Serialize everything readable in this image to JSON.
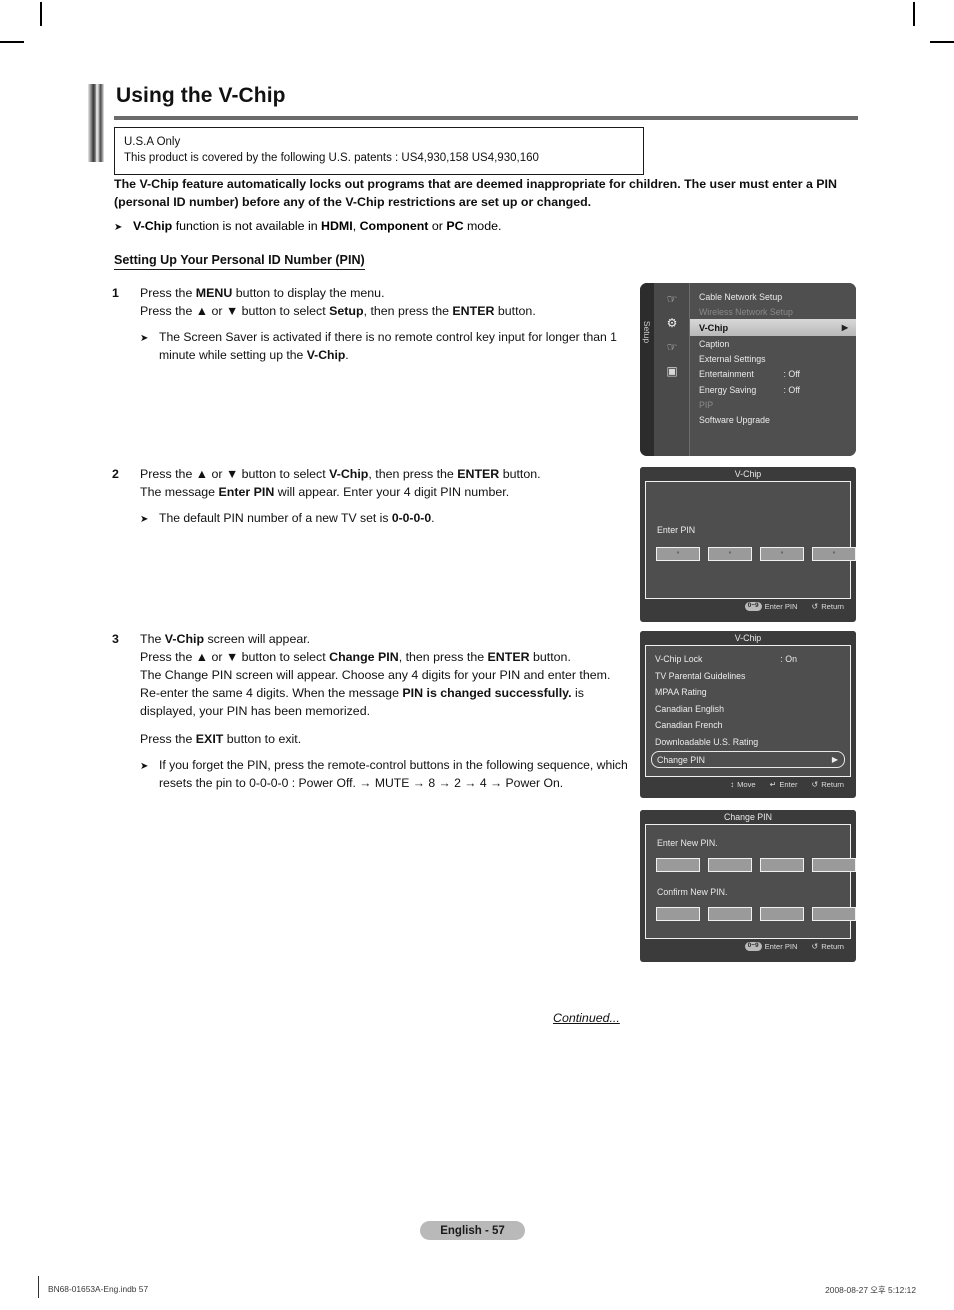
{
  "document": {
    "title": "Using the V-Chip",
    "patent_notice": {
      "line1": "U.S.A Only",
      "line2": "This product is covered by the following U.S. patents : US4,930,158 US4,930,160"
    },
    "lead_paragraph": "The V-Chip feature automatically locks out programs that are deemed inappropriate for children. The user must enter a PIN (personal ID number) before any of the V-Chip restrictions are set up or changed.",
    "lead_bullet": "V-Chip function is not available in HDMI, Component or PC mode.",
    "section_heading": "Setting Up Your Personal ID Number (PIN)",
    "continued_label": "Continued...",
    "page_label": "English - 57",
    "footer_left": "BN68-01653A-Eng.indb   57",
    "footer_right": "2008-08-27   오후 5:12:12"
  },
  "steps": [
    {
      "number": "1",
      "lines": [
        "Press the MENU button to display the menu.",
        "Press the ▲ or ▼ button to select Setup, then press the ENTER button."
      ],
      "bullet": "The Screen Saver is activated if there is no remote control key input for longer than 1 minute while setting up the V-Chip."
    },
    {
      "number": "2",
      "lines": [
        "Press the ▲ or ▼ button to select V-Chip, then press the ENTER button.",
        "The message Enter PIN will appear. Enter your 4 digit PIN number."
      ],
      "bullet": "The default PIN number of a new TV set is 0-0-0-0."
    },
    {
      "number": "3",
      "lines": [
        "The V-Chip screen will appear.",
        "Press the ▲ or ▼ button to select Change PIN, then press the ENTER button.",
        "The Change PIN screen will appear. Choose any 4 digits for your PIN and enter them. Re-enter the same 4 digits. When the message PIN is changed successfully. is displayed, your PIN has been memorized."
      ],
      "extra_line": "Press the EXIT button to exit.",
      "bullet": "If you forget the PIN, press the remote-control buttons in the following sequence, which resets the pin to 0-0-0-0 : Power Off. → MUTE → 8 → 2 → 4 → Power On."
    }
  ],
  "osd_setup_menu": {
    "tab_label": "Setup",
    "icons": [
      "hand-icon",
      "gear-icon",
      "plug-icon",
      "screen-icon"
    ],
    "rows": [
      {
        "label": "Cable Network Setup",
        "value": "",
        "state": "normal"
      },
      {
        "label": "Wireless Network Setup",
        "value": "",
        "state": "dim"
      },
      {
        "label": "V-Chip",
        "value": "",
        "state": "highlight",
        "caret": "▶"
      },
      {
        "label": "Caption",
        "value": "",
        "state": "normal"
      },
      {
        "label": "External Settings",
        "value": "",
        "state": "normal"
      },
      {
        "label": "Entertainment",
        "value": ": Off",
        "state": "normal"
      },
      {
        "label": "Energy Saving",
        "value": ": Off",
        "state": "normal"
      },
      {
        "label": "PIP",
        "value": "",
        "state": "dim"
      },
      {
        "label": "Software Upgrade",
        "value": "",
        "state": "normal"
      }
    ]
  },
  "osd_enter_pin": {
    "title": "V-Chip",
    "prompt": "Enter PIN",
    "digits": [
      "*",
      "*",
      "*",
      "*"
    ],
    "footer": [
      {
        "keycap": "0~9",
        "label": "Enter PIN"
      },
      {
        "glyph": "↺",
        "label": "Return"
      }
    ]
  },
  "osd_vchip_menu": {
    "title": "V-Chip",
    "rows": [
      {
        "label": "V-Chip Lock",
        "value": ": On",
        "boxed": false
      },
      {
        "label": "TV Parental Guidelines",
        "value": "",
        "boxed": false
      },
      {
        "label": "MPAA Rating",
        "value": "",
        "boxed": false
      },
      {
        "label": "Canadian English",
        "value": "",
        "boxed": false
      },
      {
        "label": "Canadian French",
        "value": "",
        "boxed": false
      },
      {
        "label": "Downloadable U.S. Rating",
        "value": "",
        "boxed": false
      },
      {
        "label": "Change PIN",
        "value": "",
        "boxed": true,
        "caret": "▶"
      }
    ],
    "footer": [
      {
        "glyph": "↕",
        "label": "Move"
      },
      {
        "glyph": "↵",
        "label": "Enter"
      },
      {
        "glyph": "↺",
        "label": "Return"
      }
    ]
  },
  "osd_change_pin": {
    "title": "Change PIN",
    "prompt_new": "Enter New PIN.",
    "prompt_confirm": "Confirm New PIN.",
    "footer": [
      {
        "keycap": "0~9",
        "label": "Enter PIN"
      },
      {
        "glyph": "↺",
        "label": "Return"
      }
    ]
  },
  "colors": {
    "osd_panel": "#3b3b3b",
    "osd_inner": "#4e4e4e",
    "osd_highlight": "#d0d0d0",
    "page_pill": "#b9b9b9"
  }
}
